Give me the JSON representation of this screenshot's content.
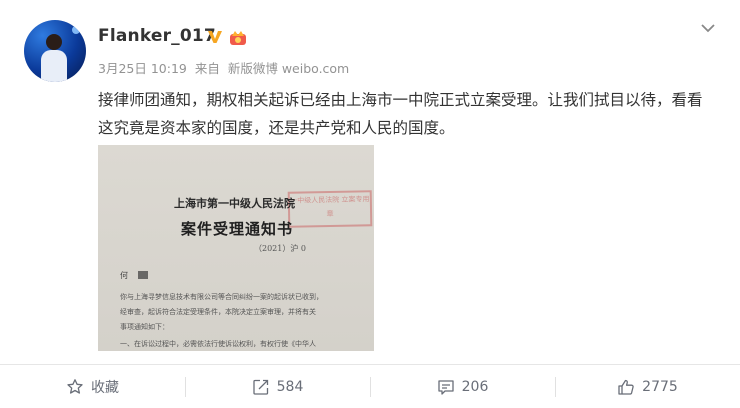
{
  "post": {
    "author": "Flanker_017",
    "date": "3月25日 10:19",
    "source_prefix": "来自",
    "source_name": "新版微博 weibo.com",
    "text": "接律师团通知，期权相关起诉已经由上海市一中院正式立案受理。让我们拭目以待，看看这究竟是资本家的国度，还是共产党和人民的国度。",
    "image": {
      "court_name": "上海市第一中级人民法院",
      "doc_title": "案件受理通知书",
      "case_no": "（2021）沪 0",
      "stamp_text": "一中级人民法院 立案专用章",
      "salutation": "何",
      "body_lines": [
        "你与上海寻梦信息技术有限公司等合同纠纷一案的起诉状已收到，",
        "经审查，起诉符合法定受理条件，本院决定立案审理，并将有关",
        "事项通知如下：",
        "一、在诉讼过程中，必需依法行使诉讼权利，有权行使《中华人"
      ]
    }
  },
  "actions": {
    "favorite_label": "收藏",
    "repost_count": "584",
    "comment_count": "206",
    "like_count": "2775"
  },
  "colors": {
    "verified_gold": "#f6a623",
    "meta_gray": "#939393",
    "text": "#333333"
  }
}
